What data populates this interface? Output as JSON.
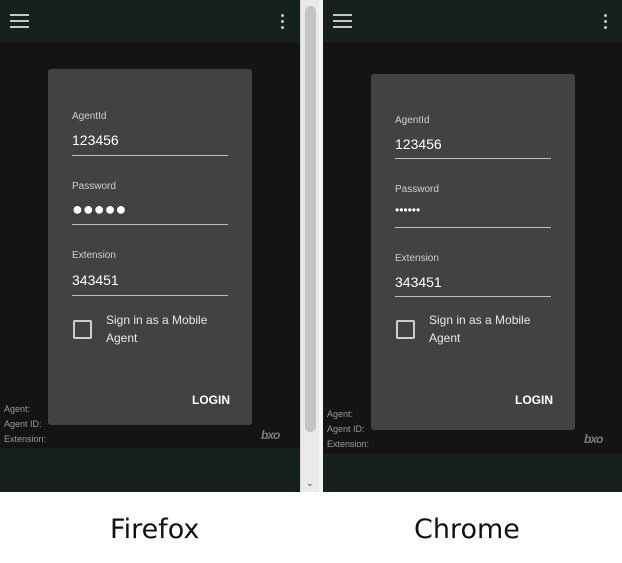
{
  "login_form": {
    "agent_id_label": "AgentId",
    "agent_id_value": "123456",
    "password_label": "Password",
    "extension_label": "Extension",
    "extension_value": "343451",
    "mobile_checkbox_label": "Sign in as a Mobile Agent",
    "mobile_checkbox_checked": false,
    "login_label": "LOGIN"
  },
  "browsers": {
    "firefox": {
      "caption": "Firefox",
      "password_mask": "●●●●●"
    },
    "chrome": {
      "caption": "Chrome",
      "password_mask": "••••••"
    }
  },
  "status": {
    "agent_label": "Agent:",
    "agent_id_label": "Agent ID:",
    "extension_label": "Extension:"
  },
  "logo_text": "bxo",
  "icons": {
    "menu": "hamburger-menu-icon",
    "more": "more-vertical-icon",
    "scroll_down": "scroll-down-arrow-icon"
  },
  "colors": {
    "background": "#141414",
    "bars": "#15201f",
    "card": "#424242",
    "text": "#ffffff"
  }
}
